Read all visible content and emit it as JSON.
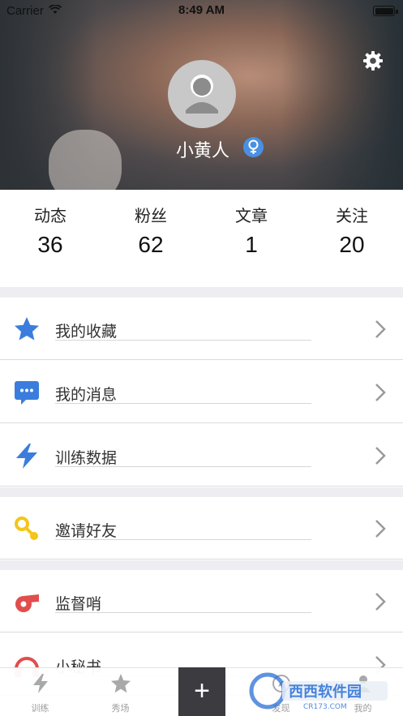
{
  "status_bar": {
    "carrier": "Carrier",
    "time": "8:49 AM"
  },
  "profile": {
    "username": "小黄人",
    "gender_symbol": "♀",
    "settings_icon": "gear-icon",
    "avatar_icon": "person-silhouette-icon"
  },
  "stats": [
    {
      "label": "动态",
      "value": "36"
    },
    {
      "label": "粉丝",
      "value": "62"
    },
    {
      "label": "文章",
      "value": "1"
    },
    {
      "label": "关注",
      "value": "20"
    }
  ],
  "menu": [
    {
      "label": "我的收藏",
      "icon": "star-icon",
      "color": "#3b7ddd"
    },
    {
      "label": "我的消息",
      "icon": "message-icon",
      "color": "#3b7ddd"
    },
    {
      "label": "训练数据",
      "icon": "lightning-icon",
      "color": "#3b7ddd"
    },
    {
      "label": "邀请好友",
      "icon": "key-icon",
      "color": "#f5c518"
    },
    {
      "label": "监督哨",
      "icon": "whistle-icon",
      "color": "#e04e4e"
    },
    {
      "label": "小秘书",
      "icon": "headphones-icon",
      "color": "#e04e4e"
    }
  ],
  "tabbar": [
    {
      "label": "训练",
      "icon": "lightning-icon"
    },
    {
      "label": "秀场",
      "icon": "star-icon"
    },
    {
      "label": "+",
      "icon": "plus-icon"
    },
    {
      "label": "发现",
      "icon": "compass-icon"
    },
    {
      "label": "我的",
      "icon": "person-icon"
    }
  ],
  "watermark": {
    "text": "西西软件园",
    "sub": "CR173.COM"
  }
}
